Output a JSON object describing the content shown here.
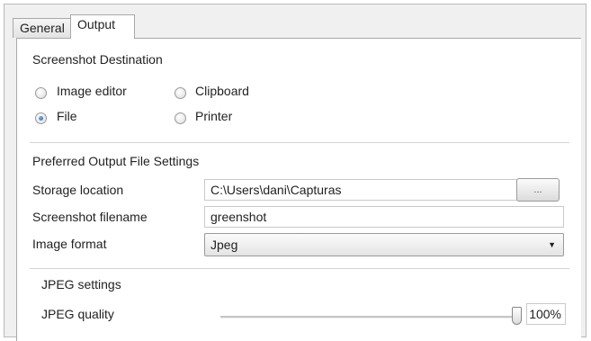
{
  "tabs": [
    {
      "label": "General",
      "active": false
    },
    {
      "label": "Output",
      "active": true
    }
  ],
  "destination": {
    "title": "Screenshot Destination",
    "options": [
      {
        "label": "Image editor",
        "checked": false
      },
      {
        "label": "Clipboard",
        "checked": false
      },
      {
        "label": "File",
        "checked": true
      },
      {
        "label": "Printer",
        "checked": false
      }
    ]
  },
  "output_settings": {
    "title": "Preferred Output File Settings",
    "storage_location": {
      "label": "Storage location",
      "value": "C:\\Users\\dani\\Capturas",
      "browse_label": "..."
    },
    "filename": {
      "label": "Screenshot filename",
      "value": "greenshot"
    },
    "image_format": {
      "label": "Image format",
      "value": "Jpeg"
    }
  },
  "jpeg": {
    "title": "JPEG settings",
    "quality_label": "JPEG quality",
    "quality_value": "100%",
    "quality_fraction": 1.0
  },
  "colors": {
    "panel_bg": "#ffffff",
    "frame_bg": "#f0f0f0",
    "radio_checked": "#1f5fa8"
  }
}
